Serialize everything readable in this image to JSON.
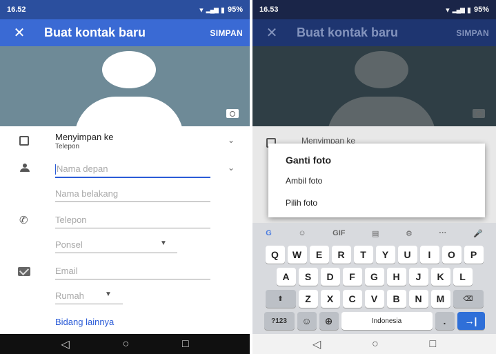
{
  "left": {
    "status": {
      "time": "16.52",
      "battery": "95%"
    },
    "appbar": {
      "close": "✕",
      "title": "Buat kontak baru",
      "save": "SIMPAN"
    },
    "storage": {
      "label": "Menyimpan ke",
      "value": "Telepon"
    },
    "fields": {
      "first_name_placeholder": "Nama depan",
      "last_name_placeholder": "Nama belakang",
      "phone_placeholder": "Telepon",
      "phone_type": "Ponsel",
      "email_placeholder": "Email",
      "email_type": "Rumah"
    },
    "more_fields": "Bidang lainnya"
  },
  "right": {
    "status": {
      "time": "16.53",
      "battery": "95%"
    },
    "appbar": {
      "close": "✕",
      "title": "Buat kontak baru",
      "save": "SIMPAN"
    },
    "storage_partial": "Menyimpan ke",
    "dialog": {
      "title": "Ganti foto",
      "options": [
        "Ambil foto",
        "Pilih foto"
      ]
    },
    "keyboard": {
      "toolbar": [
        "G",
        "☺",
        "GIF",
        "▤",
        "⚙",
        "···",
        "🎤"
      ],
      "row1": [
        "Q",
        "W",
        "E",
        "R",
        "T",
        "Y",
        "U",
        "I",
        "O",
        "P"
      ],
      "row2": [
        "A",
        "S",
        "D",
        "F",
        "G",
        "H",
        "J",
        "K",
        "L"
      ],
      "row3": [
        "Z",
        "X",
        "C",
        "V",
        "B",
        "N",
        "M"
      ],
      "shift": "⬆",
      "backspace": "⌫",
      "num_key": "?123",
      "emoji_key": "☺",
      "globe_key": "⊕",
      "space_label": "Indonesia",
      "period": ".",
      "enter": "→|"
    }
  },
  "nav": {
    "back": "◁",
    "home": "○",
    "recents": "□"
  },
  "colors": {
    "appbar": "#3a6ad4",
    "accent_link": "#2a5bd7",
    "photo_bg": "#6e8a97"
  }
}
